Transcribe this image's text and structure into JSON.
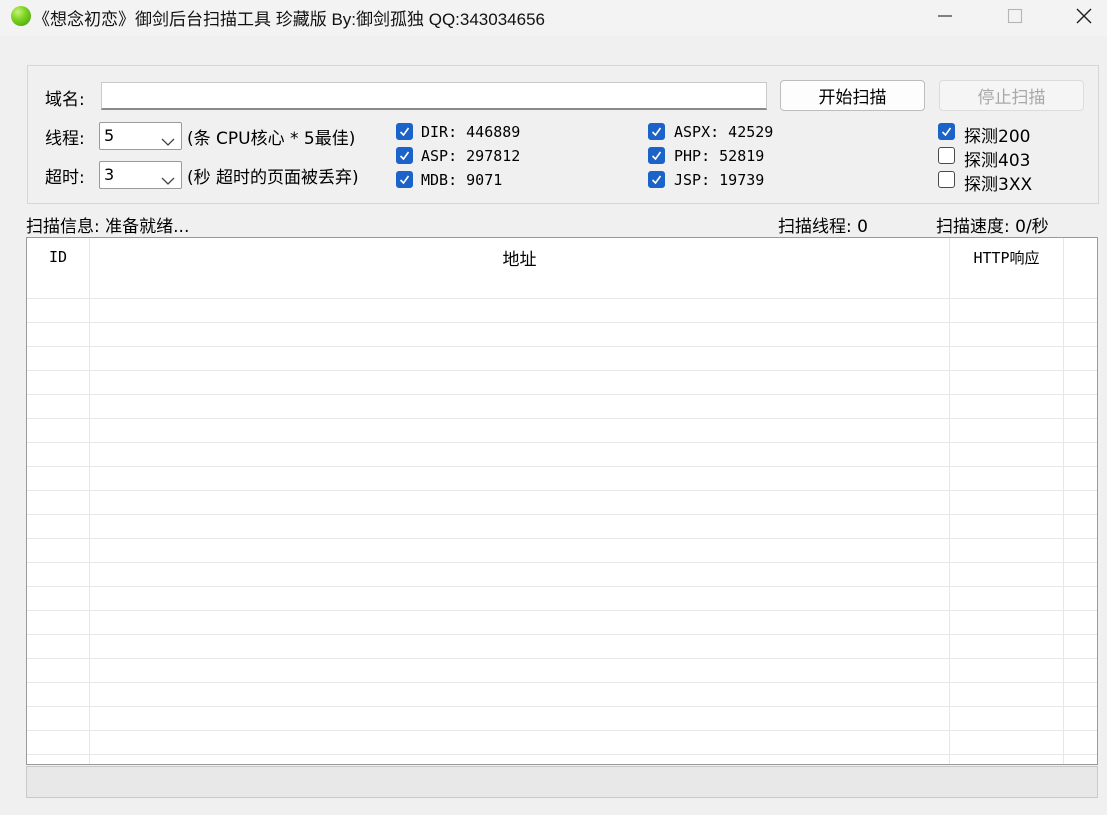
{
  "window": {
    "title": "《想念初恋》御剑后台扫描工具 珍藏版 By:御剑孤独 QQ:343034656"
  },
  "form": {
    "domain_label": "域名:",
    "domain_value": "",
    "start_button": "开始扫描",
    "stop_button": "停止扫描",
    "threads_label": "线程:",
    "threads_value": "5",
    "threads_hint": "(条 CPU核心 * 5最佳)",
    "timeout_label": "超时:",
    "timeout_value": "3",
    "timeout_hint": "(秒 超时的页面被丢弃)"
  },
  "dictionaries": [
    {
      "label": "DIR: 446889",
      "checked": true
    },
    {
      "label": "ASP: 297812",
      "checked": true
    },
    {
      "label": "MDB: 9071",
      "checked": true
    },
    {
      "label": "ASPX: 42529",
      "checked": true
    },
    {
      "label": "PHP: 52819",
      "checked": true
    },
    {
      "label": "JSP: 19739",
      "checked": true
    }
  ],
  "detect": [
    {
      "label": "探测200",
      "checked": true
    },
    {
      "label": "探测403",
      "checked": false
    },
    {
      "label": "探测3XX",
      "checked": false
    }
  ],
  "status": {
    "info": "扫描信息: 准备就绪...",
    "threads": "扫描线程: 0",
    "speed": "扫描速度: 0/秒"
  },
  "table": {
    "columns": [
      "ID",
      "地址",
      "HTTP响应"
    ],
    "rows": []
  },
  "colors": {
    "check_blue": "#1b62c9",
    "icon_green": "#7ed321"
  },
  "icons": {
    "app": "green-dot-icon",
    "minimize": "minimize-icon",
    "maximize": "maximize-icon",
    "close": "close-icon",
    "dropdown": "chevron-down-icon"
  }
}
